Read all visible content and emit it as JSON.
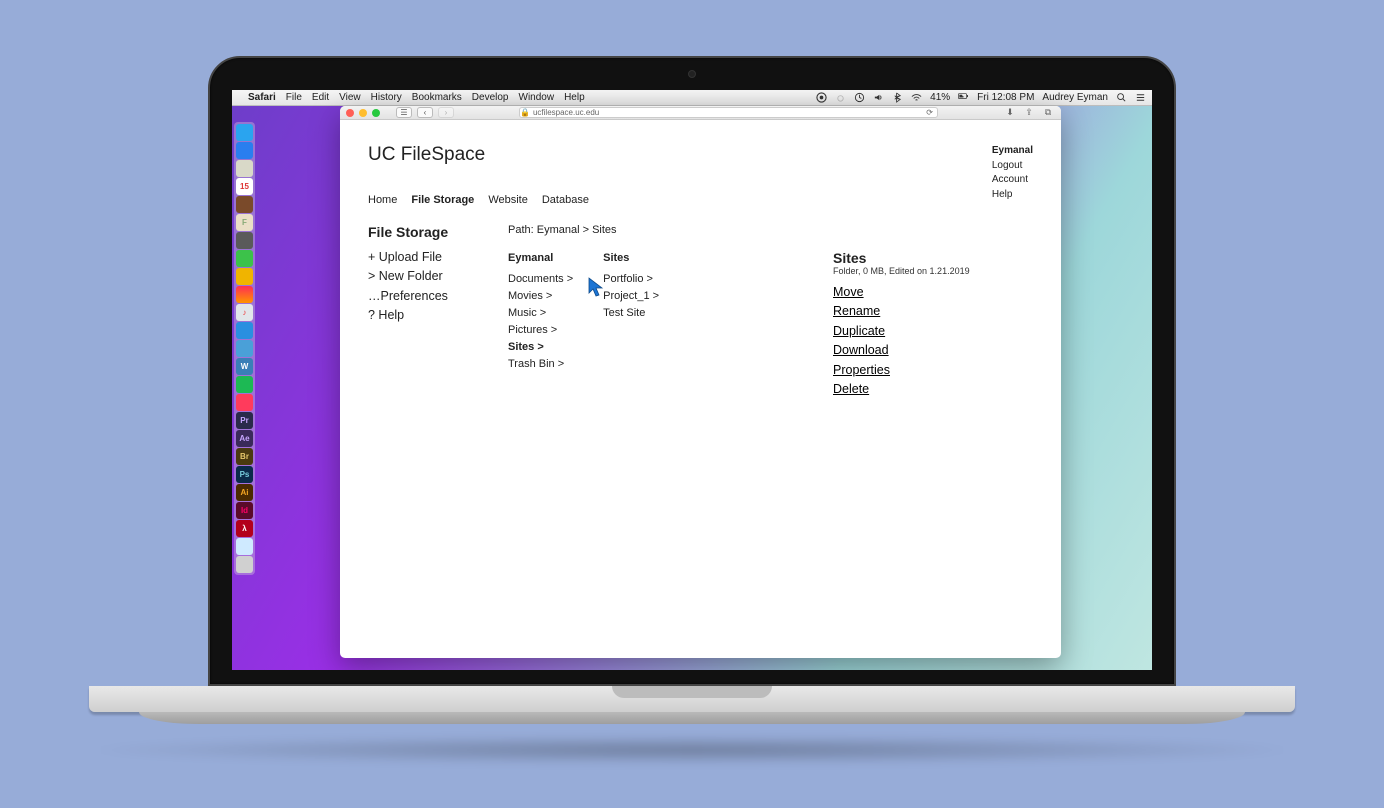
{
  "menubar": {
    "app": "Safari",
    "items": [
      "File",
      "Edit",
      "View",
      "History",
      "Bookmarks",
      "Develop",
      "Window",
      "Help"
    ],
    "battery": "41%",
    "clock": "Fri 12:08 PM",
    "user": "Audrey Eyman"
  },
  "browser": {
    "url": "ucfilespace.uc.edu"
  },
  "page": {
    "title": "UC FileSpace",
    "userNav": {
      "name": "Eymanal",
      "links": [
        "Logout",
        "Account",
        "Help"
      ]
    },
    "tabs": [
      "Home",
      "File Storage",
      "Website",
      "Database"
    ],
    "activeTab": "File Storage",
    "sectionTitle": "File Storage",
    "actions": [
      "+ Upload File",
      "> New Folder",
      "…Preferences",
      "? Help"
    ],
    "path": "Path: Eymanal > Sites",
    "col1": {
      "title": "Eymanal",
      "items": [
        "Documents >",
        "Movies >",
        "Music >",
        "Pictures >",
        "Sites >",
        "Trash Bin >"
      ],
      "activeIndex": 4
    },
    "col2": {
      "title": "Sites",
      "items": [
        "Portfolio >",
        "Project_1 >",
        "Test Site"
      ]
    },
    "detail": {
      "title": "Sites",
      "meta": "Folder, 0 MB, Edited on 1.21.2019",
      "ops": [
        "Move",
        "Rename",
        "Duplicate",
        "Download",
        "Properties",
        "Delete"
      ]
    }
  },
  "dock": [
    {
      "bg": "#2aa4ef",
      "t": ""
    },
    {
      "bg": "#2a7eef",
      "t": ""
    },
    {
      "bg": "#d9d9c8",
      "t": ""
    },
    {
      "bg": "#ffffff",
      "t": "15",
      "c": "#d33"
    },
    {
      "bg": "#7a4a2a",
      "t": ""
    },
    {
      "bg": "#eadfc6",
      "t": "F",
      "c": "#8a7"
    },
    {
      "bg": "#5a5a5a",
      "t": ""
    },
    {
      "bg": "#3cc24a",
      "t": ""
    },
    {
      "bg": "#f0b400",
      "t": ""
    },
    {
      "bg": "linear-gradient(#ff2d55,#ff9500)",
      "t": ""
    },
    {
      "bg": "#e1e6ea",
      "t": "♪",
      "c": "#e33"
    },
    {
      "bg": "#2a8fe0",
      "t": ""
    },
    {
      "bg": "#4aa0d8",
      "t": ""
    },
    {
      "bg": "#3a7fb7",
      "t": "W"
    },
    {
      "bg": "#1db954",
      "t": ""
    },
    {
      "bg": "#ff3b5c",
      "t": ""
    },
    {
      "bg": "#2a2a4a",
      "t": "Pr",
      "c": "#c8a6ff"
    },
    {
      "bg": "#3a2a5a",
      "t": "Ae",
      "c": "#c8a6ff"
    },
    {
      "bg": "#4a3a10",
      "t": "Br",
      "c": "#e5c76b"
    },
    {
      "bg": "#0a2a4a",
      "t": "Ps",
      "c": "#7cd"
    },
    {
      "bg": "#4a2a00",
      "t": "Ai",
      "c": "#f5a623"
    },
    {
      "bg": "#5a0a2a",
      "t": "Id",
      "c": "#f06"
    },
    {
      "bg": "#b3001b",
      "t": "λ"
    },
    {
      "bg": "#cfeaff",
      "t": ""
    },
    {
      "bg": "#d0d0d0",
      "t": ""
    }
  ]
}
